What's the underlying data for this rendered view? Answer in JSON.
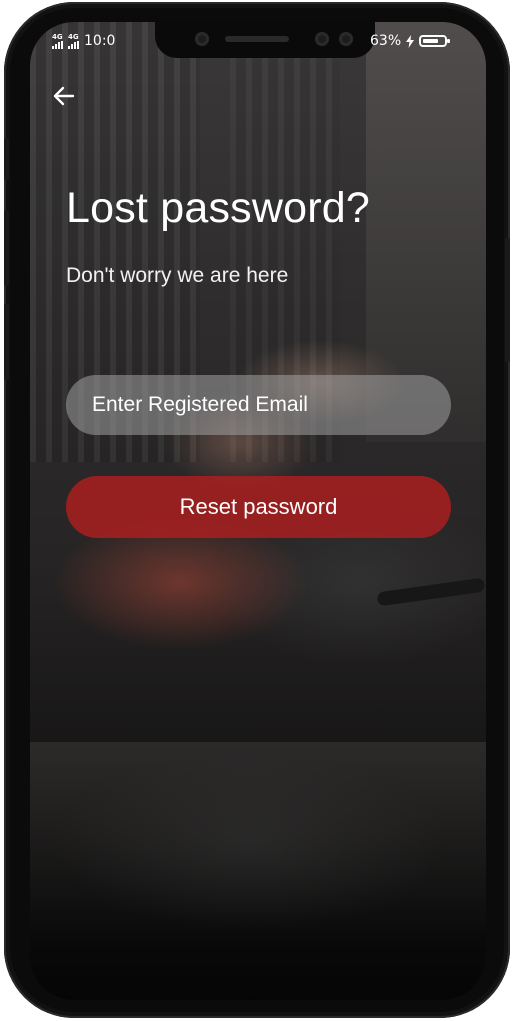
{
  "status_bar": {
    "network_1": "4G",
    "network_2": "4G",
    "time": "10:0",
    "battery_percent": "63%",
    "icons": [
      "signal-icon",
      "signal-icon",
      "charging-icon",
      "battery-icon"
    ]
  },
  "header": {
    "back_icon": "arrow-left-icon",
    "title": "Lost password?",
    "subtitle": "Don't worry we are here"
  },
  "form": {
    "email_placeholder": "Enter Registered Email",
    "email_value": "",
    "reset_label": "Reset password"
  },
  "colors": {
    "button_bg": "#b01e20",
    "input_bg": "#a0a0a0",
    "text": "#ffffff"
  }
}
